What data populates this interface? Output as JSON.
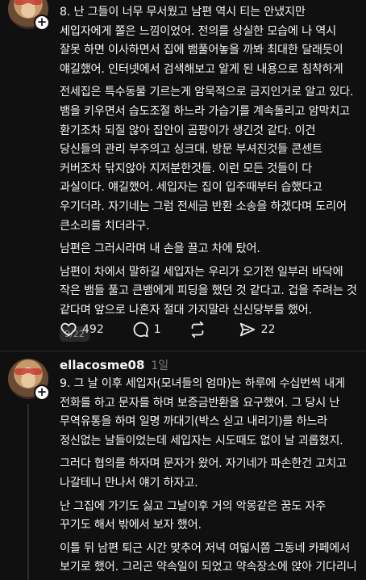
{
  "post1": {
    "paragraphs": [
      "8. 난 그들이 너무 무서웠고 남편 역시 티는 안냈지만 세입자에게 쫄은 느낌이었어. 전의를 상실한 모습에 나 역시 잘못 하면 이사하면서 집에 뱀풀어놓을 까봐 최대한 달래듯이 얘길했어. 인터넷에서 검색해보고 알게 된 내용으로 침착하게",
      "전세집은 특수동물 기르는게 암묵적으로 금지인거로 알고 있다. 뱀을 키우면서 습도조절 하느라 가습기를 계속돌리고 암막치고 환기조차 되질 않아 집안이 곰팡이가 생긴것 같다. 이건 당신들의 관리 부주의고 싱크대. 방문 부셔진것들 콘센트 커버조차 닦지않아 지저분한것들. 이런 모든 것들이 다 과실이다. 얘길했어. 세입자는 집이 입주때부터 습했다고 우기더라. 자기네는 그럼 전세금 반환 소송을 하겠다며 도리어 큰소리를 치더라구.",
      "남편은 그러시라며 내 손을 끌고 차에 탔어.",
      "남편이 차에서 말하길 세입자는 우리가 오기전 일부러 바닥에 작은 뱀들 풀고 큰뱀에게 피딩을 했던 것 같다고. 겁을 주려는 것 같다며 앞으로 나혼자 절대 가지말라 신신당부를 했어."
    ],
    "page_indicator": "9/22",
    "likes": "492",
    "comments": "1",
    "reposts": "",
    "shares": "22"
  },
  "post2": {
    "author": "ellacosme08",
    "time": "1일",
    "paragraphs": [
      "9. 그 날 이후 세입자(모녀들의 엄마)는 하루에 수십번씩 내게 전화를 하고 문자를 하며 보증금반환을 요구했어. 그 당시 난 무역유통을 하며 일명 까대기(박스 싣고 내리기)를 하느라 정신없는 날들이었는데 세입자는 시도때도 없이 날 괴롭혔지.",
      "그러다 협의를 하자며 문자가 왔어. 자기네가 파손한건 고치고 나갈테니 만나서 얘기 하자고.",
      "난 그집에 가기도 싫고 그날이후 거의 악몽같은 꿈도 자주 꾸기도 해서 밖에서 보자 했어.",
      "이틀 뒤 남편 퇴근 시간 맞추어 저녁 여덟시쯤 그동네 카페에서 보기로 했어. 그리곤 약속일이 되었고 약속장소에 앉아 기다리니 두모녀가 들어오더라. 그들이 다가오는데 그집에서 맡았던"
    ]
  },
  "icons": {
    "like": "heart-icon",
    "comment": "comment-icon",
    "repost": "repost-icon",
    "share": "send-icon",
    "follow": "plus-icon"
  },
  "colors": {
    "background": "#101010",
    "text": "#f3f5f7",
    "muted": "#7a7a7a"
  }
}
